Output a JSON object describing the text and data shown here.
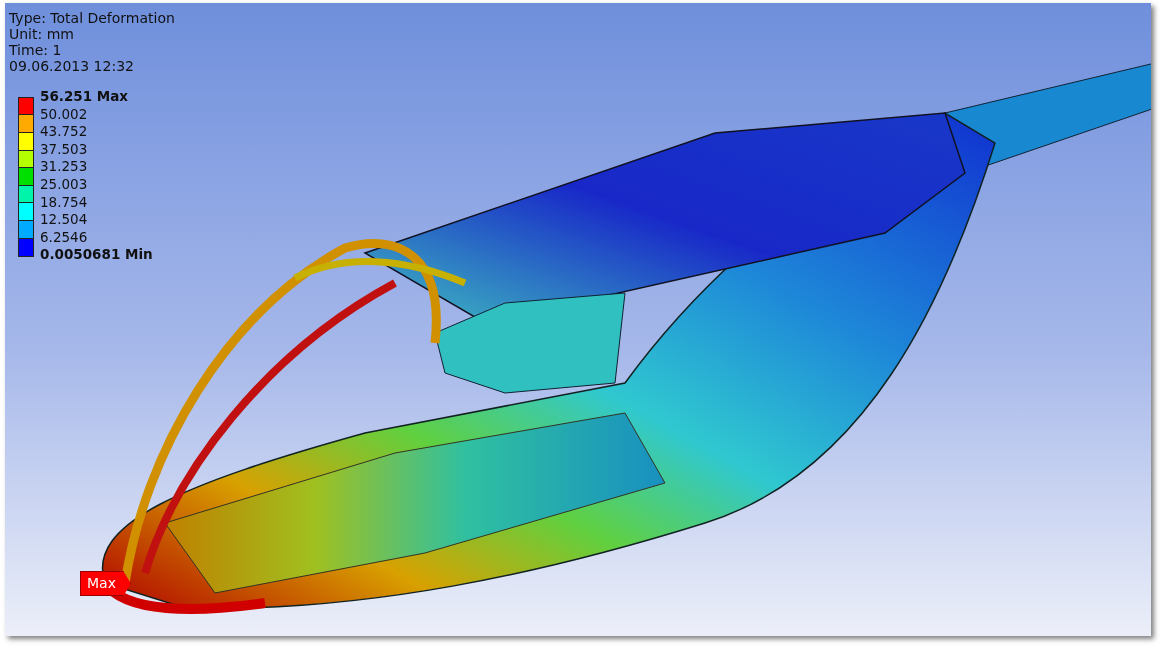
{
  "result_header": [
    "Type: Total Deformation",
    "Unit: mm",
    "Time: 1",
    "09.06.2013 12:32"
  ],
  "legend": {
    "labels": [
      {
        "text": "56.251 Max",
        "kind": "max"
      },
      {
        "text": "50.002",
        "kind": "level"
      },
      {
        "text": "43.752",
        "kind": "level"
      },
      {
        "text": "37.503",
        "kind": "level"
      },
      {
        "text": "31.253",
        "kind": "level"
      },
      {
        "text": "25.003",
        "kind": "level"
      },
      {
        "text": "18.754",
        "kind": "level"
      },
      {
        "text": "12.504",
        "kind": "level"
      },
      {
        "text": "6.2546",
        "kind": "level"
      },
      {
        "text": "0.0050681 Min",
        "kind": "min"
      }
    ],
    "bands": [
      {
        "color": "#ff0000"
      },
      {
        "color": "#ffaa00"
      },
      {
        "color": "#ffff00"
      },
      {
        "color": "#b4ff00"
      },
      {
        "color": "#00e000"
      },
      {
        "color": "#00f5aa"
      },
      {
        "color": "#00ffff"
      },
      {
        "color": "#00aaff"
      },
      {
        "color": "#0000ff"
      }
    ]
  },
  "probe_label": "Max"
}
